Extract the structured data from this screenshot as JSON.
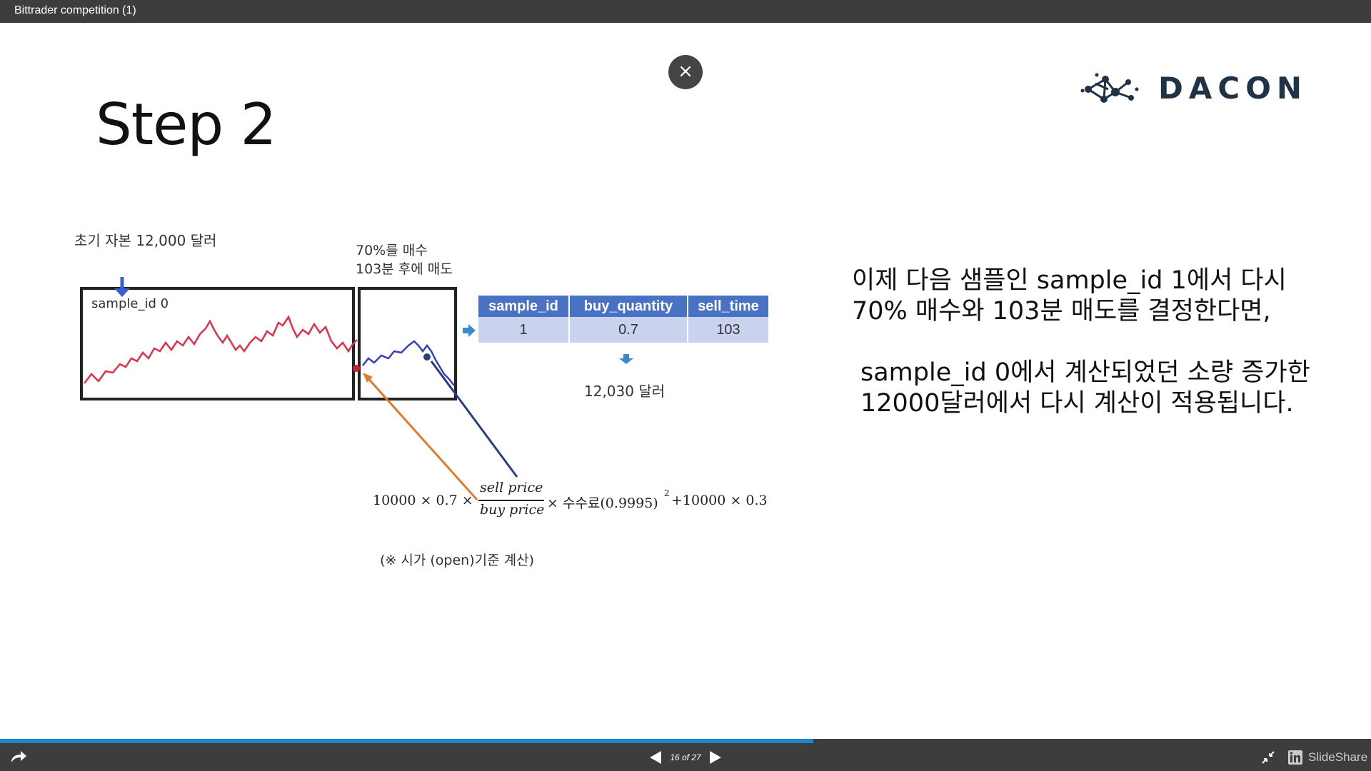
{
  "window": {
    "title": "Bittrader competition (1)"
  },
  "close_button": {
    "glyph": "×"
  },
  "logo": {
    "text": "DACON"
  },
  "slide": {
    "heading": "Step 2",
    "initial_capital": "초기 자본 12,000 달러",
    "sample_box_label": "sample_id 0",
    "buy_note_line1": "70%를 매수",
    "buy_note_line2": "103분 후에 매도",
    "table": {
      "headers": [
        "sample_id",
        "buy_quantity",
        "sell_time"
      ],
      "row": [
        "1",
        "0.7",
        "103"
      ]
    },
    "result": "12,030 달러",
    "formula": {
      "part1": "10000 × 0.7 ×",
      "numerator": "sell price",
      "denominator": "buy price",
      "part2": "× 수수료(0.9995)",
      "exponent": "2",
      "part3": "+10000 × 0.3"
    },
    "footnote": "(※ 시가 (open)기준 계산)",
    "explanation_p1": "이제 다음 샘플인 sample_id 1에서 다시 70% 매수와 103분 매도를 결정한다면,",
    "explanation_p2": "sample_id 0에서 계산되었던 소량 증가한 12000달러에서 다시 계산이 적용됩니다."
  },
  "progress": {
    "fraction": 0.593
  },
  "bottom_bar": {
    "page_indicator": "16 of 27",
    "brand": "SlideShare"
  },
  "colors": {
    "bar": "#3d3d3d",
    "progress": "#1c86c8",
    "table_header": "#4a72c4",
    "table_cell": "#c9d3ee",
    "red_line": "#e0304a",
    "blue_line": "#3a3fc0",
    "orange_arrow": "#e07b2a",
    "navy_arrow": "#2a3f80"
  }
}
